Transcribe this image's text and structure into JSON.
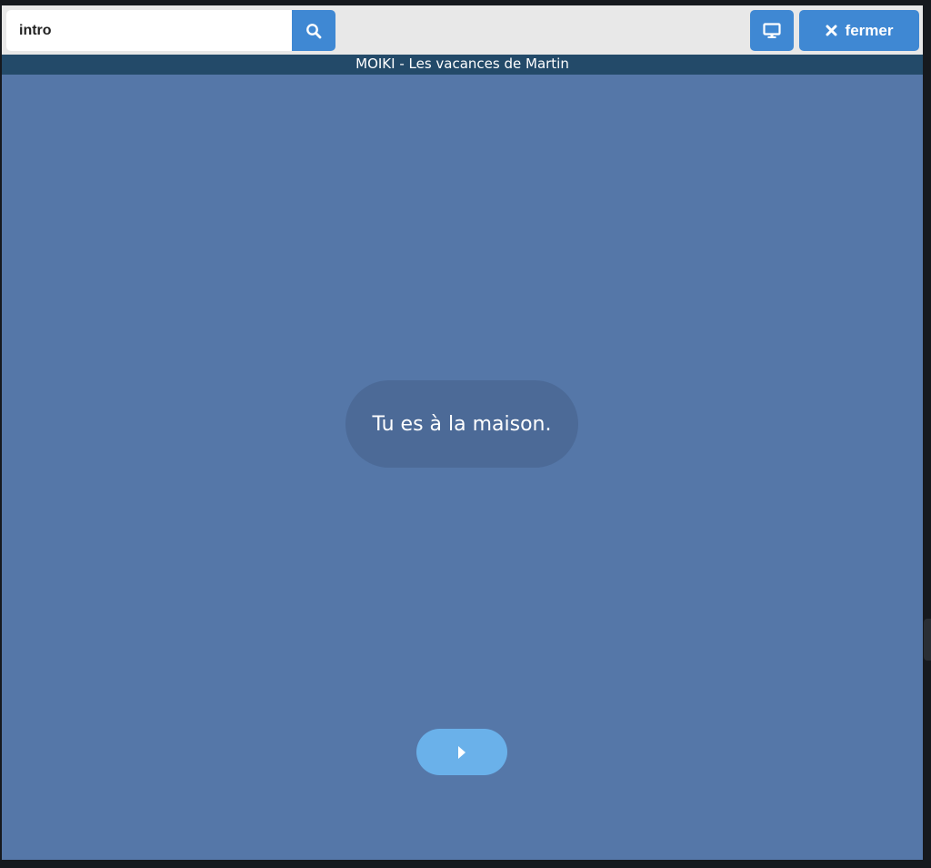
{
  "toolbar": {
    "search": {
      "value": "intro",
      "icon": "search-icon"
    },
    "screen_button": {
      "icon": "monitor-icon"
    },
    "close_button": {
      "label": "fermer",
      "icon": "close-icon"
    }
  },
  "title_bar": {
    "title": "MOIKI - Les vacances de Martin"
  },
  "story": {
    "message": "Tu es à la maison."
  },
  "play_button": {
    "icon": "play-icon"
  },
  "colors": {
    "accent": "#3f88d3",
    "stage_background": "#5577a8",
    "title_bar": "#234a69",
    "bubble": "#4c6a97",
    "play_button": "#6ab1ea",
    "toolbar": "#e8e8e8"
  }
}
